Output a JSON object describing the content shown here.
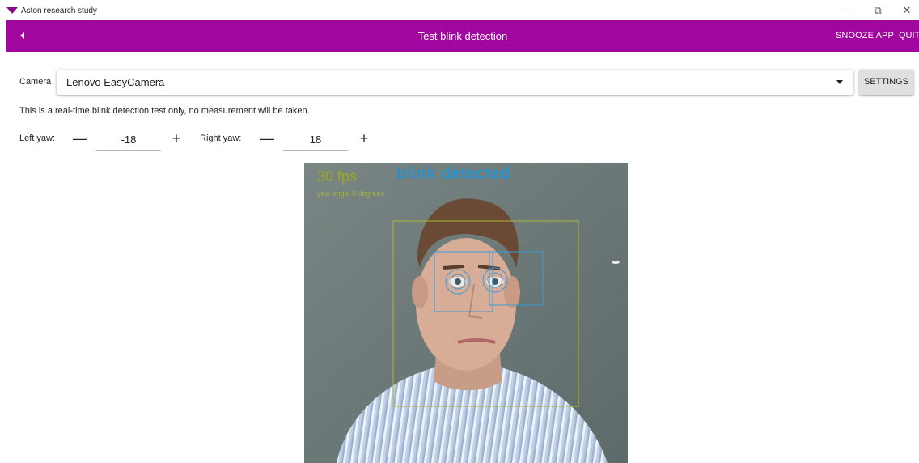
{
  "window": {
    "title": "Aston research study",
    "minimize_symbol": "–",
    "restore_symbol": "⧉",
    "close_symbol": "✕"
  },
  "header": {
    "title": "Test blink detection",
    "snooze_label": "SNOOZE APP",
    "quit_label": "QUIT",
    "background_color": "#a1079e"
  },
  "camera": {
    "label": "Camera",
    "selected": "Lenovo EasyCamera",
    "settings_label": "SETTINGS"
  },
  "info_text": "This is a real-time blink detection test only, no measurement will be taken.",
  "yaw": {
    "left_label": "Left yaw:",
    "left_value": "-18",
    "right_label": "Right yaw:",
    "right_value": "18",
    "minus_symbol": "—",
    "plus_symbol": "+"
  },
  "preview": {
    "fps_text": "30 fps",
    "status_text": "blink detected",
    "yaw_angle_text": "yaw angle 0 degrees",
    "fps_color": "#9aa81a",
    "status_color": "#2f8fc7"
  }
}
